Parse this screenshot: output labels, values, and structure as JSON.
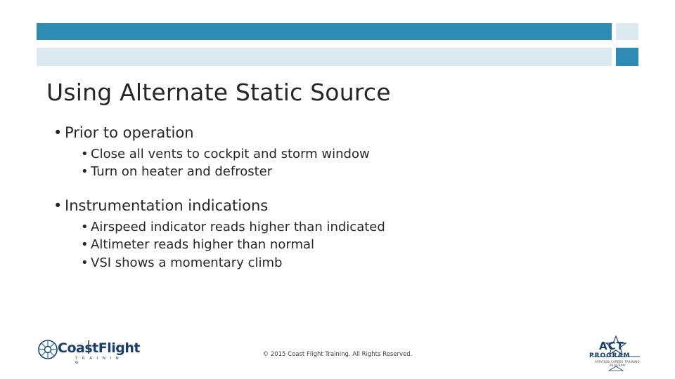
{
  "slide": {
    "title": "Using Alternate Static Source",
    "groups": [
      {
        "heading": "Prior to operation",
        "items": [
          "Close all vents to cockpit and storm window",
          "Turn on heater and defroster"
        ]
      },
      {
        "heading": "Instrumentation indications",
        "items": [
          "Airspeed indicator reads higher than indicated",
          "Altimeter reads higher than normal",
          "VSI shows a momentary climb"
        ]
      }
    ],
    "bullet_glyph": "•",
    "footer": "© 2015 Coast Flight Training. All Rights Reserved."
  },
  "logos": {
    "left": {
      "name": "CoastFlight",
      "tagline": "T R A I N I N G"
    },
    "right": {
      "name": "ACT",
      "sub": "PROGRAM",
      "tiny": "AVIATION CAREER TRAINING PROGRAM"
    }
  },
  "colors": {
    "accent": "#2e8bb4",
    "accent_light": "#dce9f0",
    "text": "#262626",
    "logo_blue": "#1b3f6b"
  }
}
